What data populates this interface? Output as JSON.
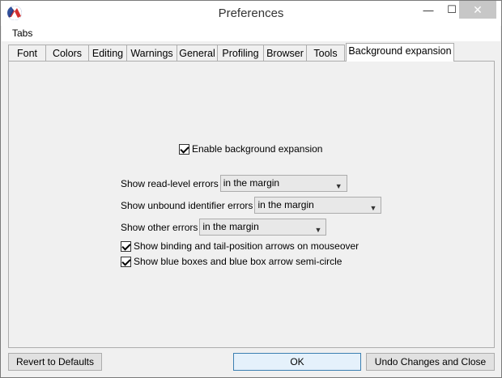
{
  "window": {
    "title": "Preferences"
  },
  "titlebar_buttons": {
    "minimize": "—",
    "maximize": "☐",
    "close": "✕"
  },
  "menu": {
    "items": [
      "Tabs"
    ]
  },
  "tabs": [
    {
      "label": "Font",
      "active": false
    },
    {
      "label": "Colors",
      "active": false
    },
    {
      "label": "Editing",
      "active": false
    },
    {
      "label": "Warnings",
      "active": false
    },
    {
      "label": "General",
      "active": false
    },
    {
      "label": "Profiling",
      "active": false
    },
    {
      "label": "Browser",
      "active": false
    },
    {
      "label": "Tools",
      "active": false
    },
    {
      "label": "Background expansion",
      "active": true
    }
  ],
  "panel": {
    "enable_checkbox": {
      "label": "Enable background expansion",
      "checked": true
    },
    "read_level": {
      "label": "Show read-level errors",
      "value": "in the margin"
    },
    "unbound": {
      "label": "Show unbound identifier errors",
      "value": "in the margin"
    },
    "other": {
      "label": "Show other errors",
      "value": "in the margin"
    },
    "binding_arrows": {
      "label": "Show binding and tail-position arrows on mouseover",
      "checked": true
    },
    "blue_boxes": {
      "label": "Show blue boxes and blue box arrow semi-circle",
      "checked": true
    }
  },
  "buttons": {
    "revert": "Revert to Defaults",
    "ok": "OK",
    "undo": "Undo Changes and Close"
  },
  "colors": {
    "icon_bg": "#1a3d8f",
    "icon_accent": "#d32f2f",
    "ok_border": "#3c7fb1"
  }
}
